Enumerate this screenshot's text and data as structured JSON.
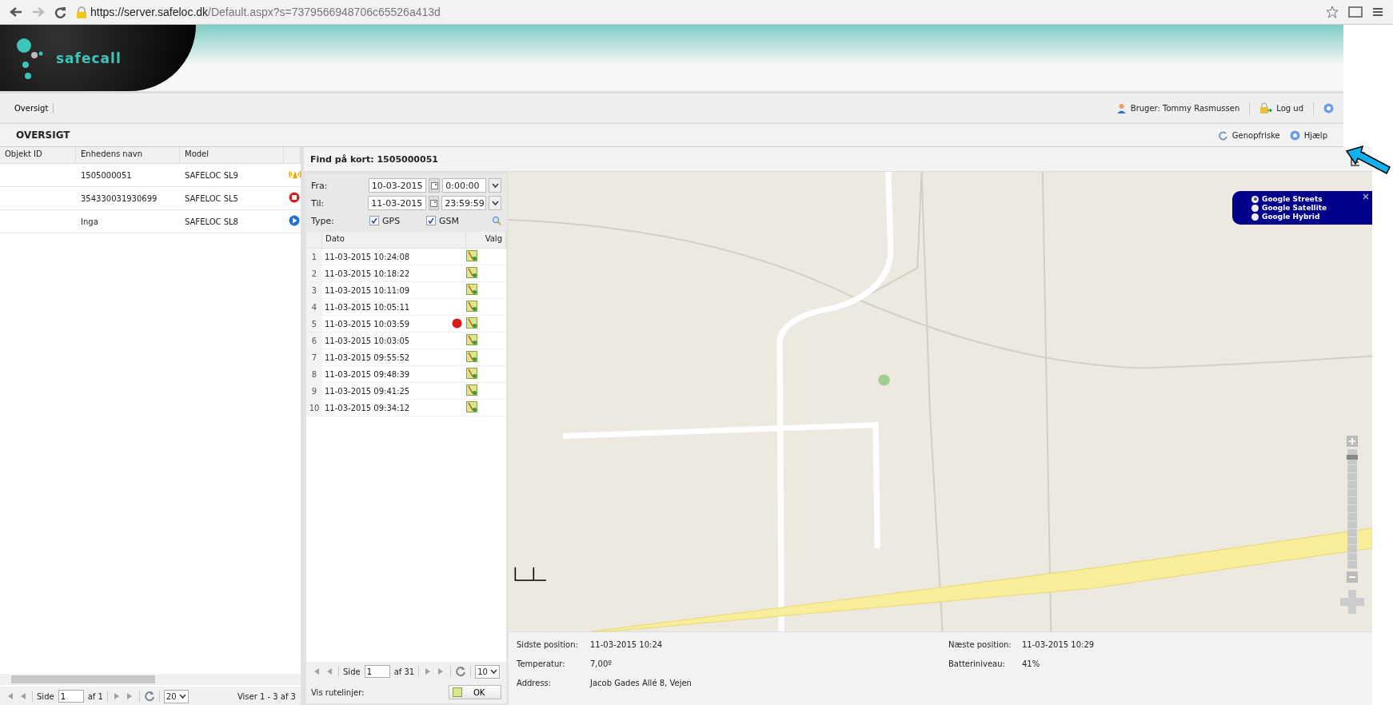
{
  "browser": {
    "url_host": "https://server.safeloc.dk",
    "url_path": "/Default.aspx?s=7379566948706c65526a413d"
  },
  "header": {
    "logo": "safecall"
  },
  "menu": {
    "items": [
      {
        "label": "Oversigt"
      }
    ],
    "user": "Bruger: Tommy Rasmussen",
    "logout": "Log ud"
  },
  "section": {
    "title": "OVERSIGT",
    "refresh": "Genopfriske",
    "help": "Hjælp"
  },
  "devices": {
    "columns": [
      "Objekt ID",
      "Enhedens navn",
      "Model"
    ],
    "rows": [
      {
        "name": "1505000051",
        "model": "SAFELOC SL9",
        "kind": "alarm"
      },
      {
        "name": "354330031930699",
        "model": "SAFELOC SL5",
        "kind": "stopped"
      },
      {
        "name": "Inga",
        "model": "SAFELOC SL8",
        "kind": "running"
      }
    ],
    "pager": {
      "page_label": "Side",
      "page": "1",
      "of": "af 1",
      "page_size": "20",
      "summary": "Viser 1 - 3 af 3"
    }
  },
  "detail": {
    "title": "Find på kort: 1505000051",
    "from": {
      "label": "Fra:",
      "date": "10-03-2015",
      "time": "0:00:00"
    },
    "to": {
      "label": "Til:",
      "date": "11-03-2015",
      "time": "23:59:59"
    },
    "type": {
      "label": "Type:",
      "options": [
        {
          "label": "GPS",
          "checked": true
        },
        {
          "label": "GSM",
          "checked": true
        }
      ]
    },
    "positions": {
      "columns": [
        "Dato",
        "Valg"
      ],
      "rows": [
        {
          "index": "1",
          "time": "11-03-2015 10:24:08",
          "marked": false
        },
        {
          "index": "2",
          "time": "11-03-2015 10:18:22",
          "marked": false
        },
        {
          "index": "3",
          "time": "11-03-2015 10:11:09",
          "marked": false
        },
        {
          "index": "4",
          "time": "11-03-2015 10:05:11",
          "marked": false
        },
        {
          "index": "5",
          "time": "11-03-2015 10:03:59",
          "marked": true
        },
        {
          "index": "6",
          "time": "11-03-2015 10:03:05",
          "marked": false
        },
        {
          "index": "7",
          "time": "11-03-2015 09:55:52",
          "marked": false
        },
        {
          "index": "8",
          "time": "11-03-2015 09:48:39",
          "marked": false
        },
        {
          "index": "9",
          "time": "11-03-2015 09:41:25",
          "marked": false
        },
        {
          "index": "10",
          "time": "11-03-2015 09:34:12",
          "marked": false
        }
      ]
    },
    "pager": {
      "page_label": "Side",
      "page": "1",
      "of": "af 31",
      "page_size": "10"
    },
    "routes": {
      "label": "Vis rutelinjer:",
      "button": "OK"
    }
  },
  "map": {
    "kind": "picture",
    "zoom": {
      "level": 0.95
    },
    "layers": [
      {
        "label": "Google Streets",
        "selected": true
      },
      {
        "label": "Google Satellite",
        "selected": false
      },
      {
        "label": "Google Hybrid",
        "selected": false
      }
    ]
  },
  "info": {
    "left": [
      {
        "label": "Sidste position:",
        "value": "11-03-2015 10:24"
      },
      {
        "label": "Temperatur:",
        "value": "7,00º"
      },
      {
        "label": "Address:",
        "value": "Jacob Gades Allé 8, Vejen"
      }
    ],
    "right": [
      {
        "label": "Næste position:",
        "value": "11-03-2015 10:29"
      },
      {
        "label": "Batteriniveau:",
        "value": "41%"
      }
    ]
  }
}
